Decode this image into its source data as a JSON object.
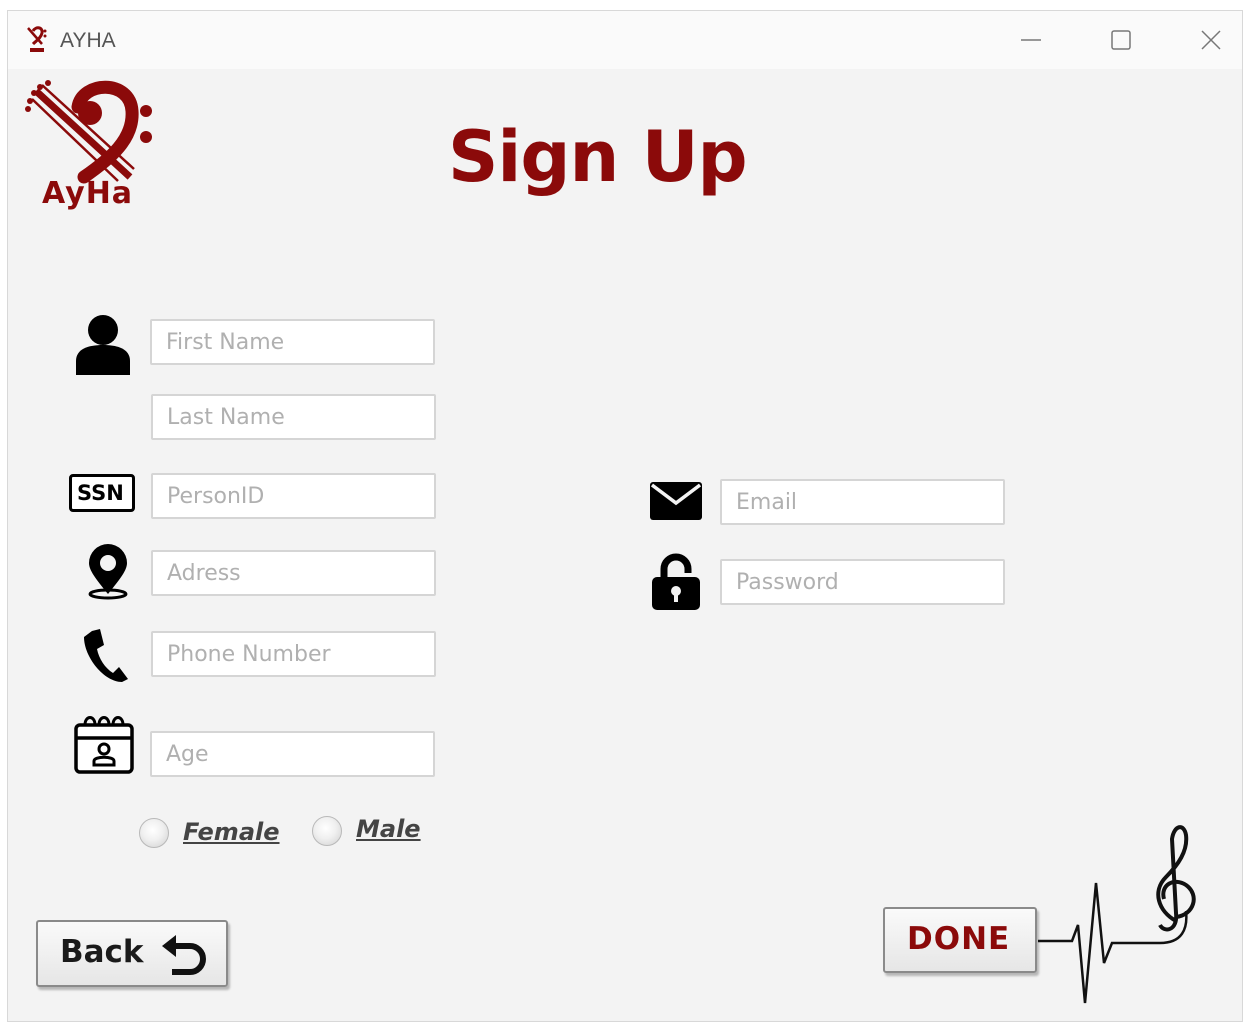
{
  "window": {
    "title": "AYHA",
    "controls": [
      "minimize-icon",
      "maximize-icon",
      "close-icon"
    ]
  },
  "header": {
    "logo_text": "AyHa",
    "title": "Sign Up"
  },
  "form": {
    "first_name": {
      "placeholder": "First Name",
      "value": ""
    },
    "last_name": {
      "placeholder": "Last Name",
      "value": ""
    },
    "ssn_icon_text": "SSN",
    "person_id": {
      "placeholder": "PersonID",
      "value": ""
    },
    "address": {
      "placeholder": "Adress",
      "value": ""
    },
    "phone": {
      "placeholder": "Phone Number",
      "value": ""
    },
    "age": {
      "placeholder": "Age",
      "value": ""
    },
    "email": {
      "placeholder": "Email",
      "value": ""
    },
    "password": {
      "placeholder": "Password",
      "value": ""
    },
    "gender": {
      "female_label": "Female",
      "male_label": "Male",
      "selected": ""
    }
  },
  "buttons": {
    "back_label": "Back",
    "done_label": "DONE"
  },
  "colors": {
    "brand": "#8b0a0a",
    "background": "#f3f3f3"
  },
  "icons": [
    "user-icon",
    "ssn-icon",
    "location-pin-icon",
    "phone-icon",
    "calendar-icon",
    "mail-icon",
    "unlock-icon",
    "undo-arrow-icon",
    "treble-clef-heartbeat-icon"
  ]
}
